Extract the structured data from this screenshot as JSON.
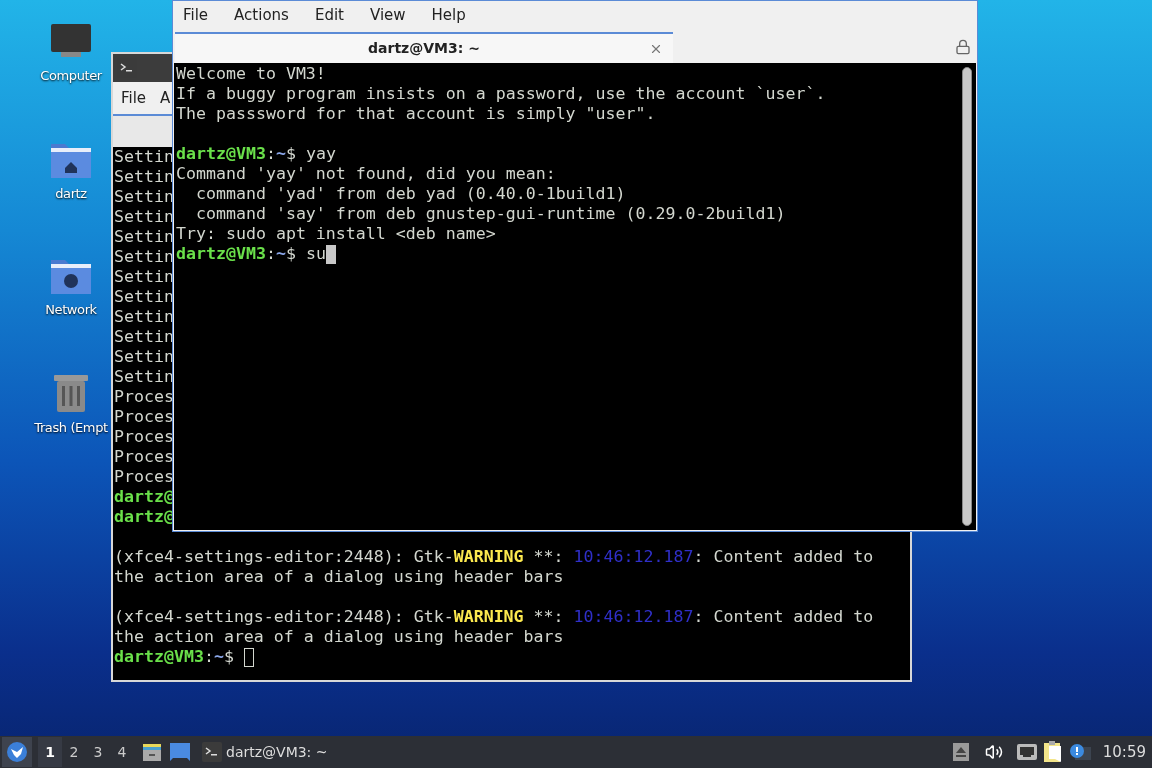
{
  "desktop_icons": [
    {
      "label": "Computer",
      "kind": "computer"
    },
    {
      "label": "dartz",
      "kind": "home"
    },
    {
      "label": "Network",
      "kind": "network"
    },
    {
      "label": "Trash (Empt",
      "kind": "trash"
    }
  ],
  "back_window": {
    "focused": false,
    "menu": [
      "File",
      "A"
    ],
    "lines": [
      {
        "kind": "text",
        "segments": [
          {
            "kind": "plain",
            "text": "Settin"
          }
        ]
      },
      {
        "kind": "text",
        "segments": [
          {
            "kind": "plain",
            "text": "Settin"
          }
        ]
      },
      {
        "kind": "text",
        "segments": [
          {
            "kind": "plain",
            "text": "Settin"
          }
        ]
      },
      {
        "kind": "text",
        "segments": [
          {
            "kind": "plain",
            "text": "Settin"
          }
        ]
      },
      {
        "kind": "text",
        "segments": [
          {
            "kind": "plain",
            "text": "Settin"
          }
        ]
      },
      {
        "kind": "text",
        "segments": [
          {
            "kind": "plain",
            "text": "Settin"
          }
        ]
      },
      {
        "kind": "text",
        "segments": [
          {
            "kind": "plain",
            "text": "Settin"
          }
        ]
      },
      {
        "kind": "text",
        "segments": [
          {
            "kind": "plain",
            "text": "Settin"
          }
        ]
      },
      {
        "kind": "text",
        "segments": [
          {
            "kind": "plain",
            "text": "Settin"
          }
        ]
      },
      {
        "kind": "text",
        "segments": [
          {
            "kind": "plain",
            "text": "Settin"
          }
        ]
      },
      {
        "kind": "text",
        "segments": [
          {
            "kind": "plain",
            "text": "Settin"
          }
        ]
      },
      {
        "kind": "text",
        "segments": [
          {
            "kind": "plain",
            "text": "Settin"
          }
        ]
      },
      {
        "kind": "text",
        "segments": [
          {
            "kind": "plain",
            "text": "Proces"
          }
        ]
      },
      {
        "kind": "text",
        "segments": [
          {
            "kind": "plain",
            "text": "Proces"
          }
        ]
      },
      {
        "kind": "text",
        "segments": [
          {
            "kind": "plain",
            "text": "Proces"
          }
        ]
      },
      {
        "kind": "text",
        "segments": [
          {
            "kind": "plain",
            "text": "Proces"
          }
        ]
      },
      {
        "kind": "text",
        "segments": [
          {
            "kind": "plain",
            "text": "Proces"
          }
        ]
      },
      {
        "kind": "text",
        "segments": [
          {
            "kind": "user",
            "text": "dartz@"
          }
        ]
      },
      {
        "kind": "text",
        "segments": [
          {
            "kind": "user",
            "text": "dartz@"
          }
        ]
      },
      {
        "kind": "blank"
      },
      {
        "kind": "text",
        "segments": [
          {
            "kind": "plain",
            "text": "(xfce4-settings-editor:2448): Gtk-"
          },
          {
            "kind": "warning",
            "text": "WARNING"
          },
          {
            "kind": "plain",
            "text": " **: "
          },
          {
            "kind": "time",
            "text": "10:46:12.187"
          },
          {
            "kind": "plain",
            "text": ": Content added to"
          }
        ]
      },
      {
        "kind": "text",
        "segments": [
          {
            "kind": "plain",
            "text": "the action area of a dialog using header bars"
          }
        ]
      },
      {
        "kind": "blank"
      },
      {
        "kind": "text",
        "segments": [
          {
            "kind": "plain",
            "text": "(xfce4-settings-editor:2448): Gtk-"
          },
          {
            "kind": "warning",
            "text": "WARNING"
          },
          {
            "kind": "plain",
            "text": " **: "
          },
          {
            "kind": "time",
            "text": "10:46:12.187"
          },
          {
            "kind": "plain",
            "text": ": Content added to"
          }
        ]
      },
      {
        "kind": "text",
        "segments": [
          {
            "kind": "plain",
            "text": "the action area of a dialog using header bars"
          }
        ]
      },
      {
        "kind": "text",
        "segments": [
          {
            "kind": "user",
            "text": "dartz@VM3"
          },
          {
            "kind": "plain",
            "text": ":"
          },
          {
            "kind": "path",
            "text": "~"
          },
          {
            "kind": "plain",
            "text": "$ "
          }
        ],
        "cursor": true
      }
    ]
  },
  "front_window": {
    "focused": true,
    "menu": [
      "File",
      "Actions",
      "Edit",
      "View",
      "Help"
    ],
    "tab": {
      "title": "dartz@VM3: ~",
      "selected": true
    },
    "lines": [
      {
        "kind": "text",
        "segments": [
          {
            "kind": "plain",
            "text": "Welcome to VM3!"
          }
        ]
      },
      {
        "kind": "text",
        "segments": [
          {
            "kind": "plain",
            "text": "If a buggy program insists on a password, use the account `user`."
          }
        ]
      },
      {
        "kind": "text",
        "segments": [
          {
            "kind": "plain",
            "text": "The passsword for that account is simply \"user\"."
          }
        ]
      },
      {
        "kind": "blank"
      },
      {
        "kind": "text",
        "segments": [
          {
            "kind": "user",
            "text": "dartz@VM3"
          },
          {
            "kind": "plain",
            "text": ":"
          },
          {
            "kind": "path",
            "text": "~"
          },
          {
            "kind": "plain",
            "text": "$ yay"
          }
        ]
      },
      {
        "kind": "text",
        "segments": [
          {
            "kind": "plain",
            "text": "Command 'yay' not found, did you mean:"
          }
        ]
      },
      {
        "kind": "text",
        "segments": [
          {
            "kind": "plain",
            "text": "  command 'yad' from deb yad (0.40.0-1build1)"
          }
        ]
      },
      {
        "kind": "text",
        "segments": [
          {
            "kind": "plain",
            "text": "  command 'say' from deb gnustep-gui-runtime (0.29.0-2build1)"
          }
        ]
      },
      {
        "kind": "text",
        "segments": [
          {
            "kind": "plain",
            "text": "Try: sudo apt install <deb name>"
          }
        ]
      },
      {
        "kind": "text",
        "segments": [
          {
            "kind": "user",
            "text": "dartz@VM3"
          },
          {
            "kind": "plain",
            "text": ":"
          },
          {
            "kind": "path",
            "text": "~"
          },
          {
            "kind": "plain",
            "text": "$ su"
          }
        ],
        "cursor": true
      }
    ]
  },
  "taskbar": {
    "workspaces": [
      {
        "label": "1",
        "selected": true
      },
      {
        "label": "2",
        "selected": false
      },
      {
        "label": "3",
        "selected": false
      },
      {
        "label": "4",
        "selected": false
      }
    ],
    "task": "dartz@VM3: ~",
    "clock": "10:59"
  }
}
